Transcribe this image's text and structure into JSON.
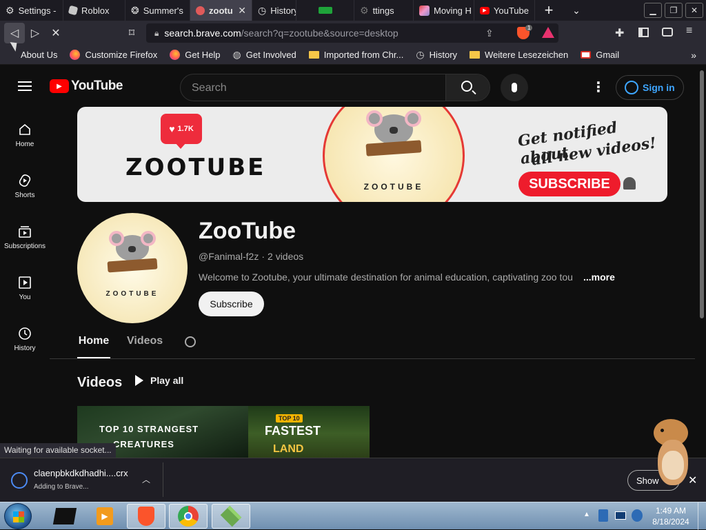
{
  "tabs": [
    {
      "label": "Settings -",
      "icon": "gear-icon",
      "active": false
    },
    {
      "label": "Roblox",
      "icon": "roblox-icon",
      "active": false
    },
    {
      "label": "Summer's",
      "icon": "summer-icon",
      "active": false
    },
    {
      "label": "zootu",
      "icon": "zootube-icon",
      "active": true
    },
    {
      "label": "History",
      "icon": "history-icon",
      "active": false
    },
    {
      "label": "",
      "icon": "green-icon",
      "active": false
    },
    {
      "label": "ttings",
      "icon": "settings-icon",
      "active": false
    },
    {
      "label": "Moving H",
      "icon": "image-icon",
      "active": false
    },
    {
      "label": "YouTube",
      "icon": "youtube-icon",
      "active": false
    }
  ],
  "address": {
    "url_host": "search.brave.com",
    "url_path": "/search?q=zootube&source=desktop",
    "shields_count": "1"
  },
  "bookmarks": [
    {
      "label": "About Us",
      "icon": "cursor-icon"
    },
    {
      "label": "Customize Firefox",
      "icon": "firefox-icon"
    },
    {
      "label": "Get Help",
      "icon": "firefox-icon"
    },
    {
      "label": "Get Involved",
      "icon": "globe-icon"
    },
    {
      "label": "Imported from Chr...",
      "icon": "folder-icon"
    },
    {
      "label": "History",
      "icon": "history-icon"
    },
    {
      "label": "Weitere Lesezeichen",
      "icon": "folder-icon"
    },
    {
      "label": "Gmail",
      "icon": "gmail-icon"
    }
  ],
  "youtube": {
    "logo_text": "YouTube",
    "search_placeholder": "Search",
    "sign_in": "Sign in",
    "sidebar": [
      {
        "label": "Home",
        "icon": "home-icon"
      },
      {
        "label": "Shorts",
        "icon": "shorts-icon"
      },
      {
        "label": "Subscriptions",
        "icon": "subscriptions-icon"
      },
      {
        "label": "You",
        "icon": "you-icon"
      },
      {
        "label": "History",
        "icon": "history-icon"
      }
    ],
    "banner": {
      "likes": "1.7K",
      "brand": "ZOOTUBE",
      "circle_text": "ZOOTUBE",
      "notify_line1": "Get notified about",
      "notify_line2": "all new videos!",
      "subscribe": "SUBSCRIBE"
    },
    "channel": {
      "name": "ZooTube",
      "avatar_text": "ZOOTUBE",
      "handle": "@Fanimal-f2z",
      "separator": "·",
      "video_count": "2 videos",
      "description": "Welcome to Zootube, your ultimate destination for animal education, captivating zoo tou",
      "more": "...more",
      "subscribe": "Subscribe"
    },
    "tabs": [
      {
        "label": "Home",
        "active": true
      },
      {
        "label": "Videos",
        "active": false
      }
    ],
    "section_title": "Videos",
    "play_all": "Play all",
    "videos": [
      {
        "line1": "TOP 10 STRANGEST",
        "line2": "CREATURES"
      },
      {
        "badge": "TOP 10",
        "line1": "FASTEST",
        "line2": "LAND"
      }
    ]
  },
  "status_text": "Waiting for available socket...",
  "download": {
    "filename": "claenpbkdkdhadhi....crx",
    "status": "Adding to Brave...",
    "show_all": "Show"
  },
  "clock": {
    "time": "1:49 AM",
    "date": "8/18/2024"
  },
  "colors": {
    "accent_red": "#ff0000",
    "signin_blue": "#3ea6ff",
    "folder": "#f6c648"
  }
}
